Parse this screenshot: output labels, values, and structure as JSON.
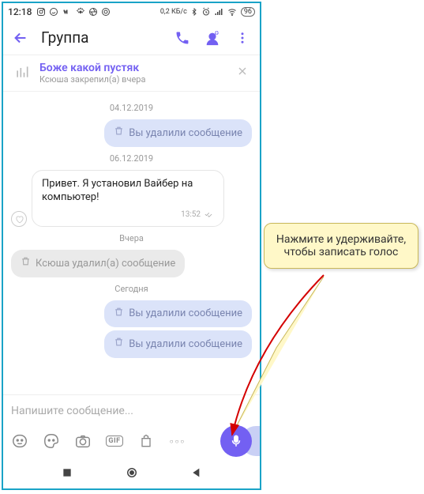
{
  "status": {
    "time": "12:18",
    "data_rate": "0,2 КБ/с",
    "battery": "96"
  },
  "header": {
    "title": "Группа"
  },
  "pinned": {
    "title": "Боже какой пустяк",
    "subtitle": "Ксюша закрепил(а) вчера"
  },
  "dates": {
    "d1": "04.12.2019",
    "d2": "06.12.2019",
    "d3": "Вчера",
    "d4": "Сегодня"
  },
  "msg": {
    "deleted_out": "Вы удалили сообщение",
    "incoming_text": "Привет. Я установил Вайбер на компьютер!",
    "incoming_time": "13:52",
    "deleted_in": "Ксюша удалил(а) сообщение"
  },
  "input": {
    "placeholder": "Напишите сообщение...",
    "gif": "GIF",
    "more": "○○○"
  },
  "callout": {
    "text": "Нажмите и удерживайте, чтобы записать голос"
  }
}
